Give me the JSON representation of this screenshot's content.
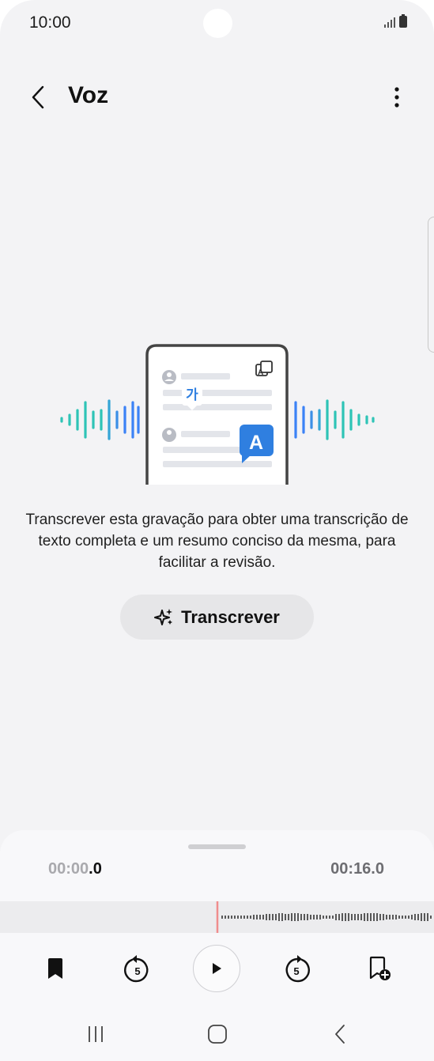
{
  "status_bar": {
    "time": "10:00",
    "icons": [
      "signal-icon",
      "battery-icon"
    ]
  },
  "header": {
    "title": "Voz",
    "back_icon": "chevron-left-icon",
    "more_icon": "more-vertical-icon"
  },
  "illustration": {
    "glyph_korean": "가",
    "glyph_latin": "A",
    "icons": [
      "translate-icon",
      "person-icon"
    ]
  },
  "main": {
    "description": "Transcrever esta gravação para obter uma transcrição de texto completa e um resumo conciso da mesma, para facilitar a revisão.",
    "transcribe_button": {
      "label": "Transcrever",
      "icon": "sparkle-icon"
    }
  },
  "player": {
    "current_time_dim": "00:00",
    "current_time_fraction": ".0",
    "total_time": "00:16.0",
    "playhead_color": "#f08d8d",
    "controls": [
      "bookmark-icon",
      "rewind-5-icon",
      "play-icon",
      "forward-5-icon",
      "add-bookmark-icon"
    ],
    "skip_seconds": "5"
  },
  "navigation": [
    "recent-apps-icon",
    "home-icon",
    "back-icon"
  ],
  "colors": {
    "accent": "#2f7fe0",
    "wave_teal": "#2ec4b6",
    "wave_blue": "#3b82f6"
  }
}
